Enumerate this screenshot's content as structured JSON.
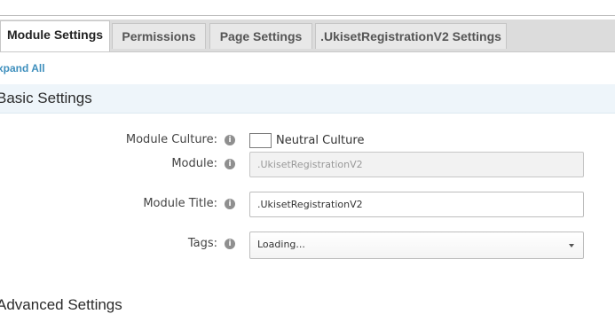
{
  "tabs": [
    {
      "label": "Module Settings",
      "active": true
    },
    {
      "label": "Permissions",
      "active": false
    },
    {
      "label": "Page Settings",
      "active": false
    },
    {
      "label": ".UkisetRegistrationV2 Settings",
      "active": false
    }
  ],
  "expand_all": "xpand All",
  "basic_settings": {
    "title": "Basic Settings",
    "module_culture": {
      "label": "Module Culture:",
      "checkbox_label": "Neutral Culture",
      "checked": false
    },
    "module": {
      "label": "Module:",
      "value": ".UkisetRegistrationV2"
    },
    "module_title": {
      "label": "Module Title:",
      "value": ".UkisetRegistrationV2"
    },
    "tags": {
      "label": "Tags:",
      "value": "Loading..."
    }
  },
  "advanced_settings": {
    "title": "Advanced Settings"
  },
  "colors": {
    "link": "#3e8fbd",
    "section_bg": "#eef5fa"
  },
  "icons": {
    "info": "info-icon",
    "dropdown": "chevron-down-icon"
  }
}
